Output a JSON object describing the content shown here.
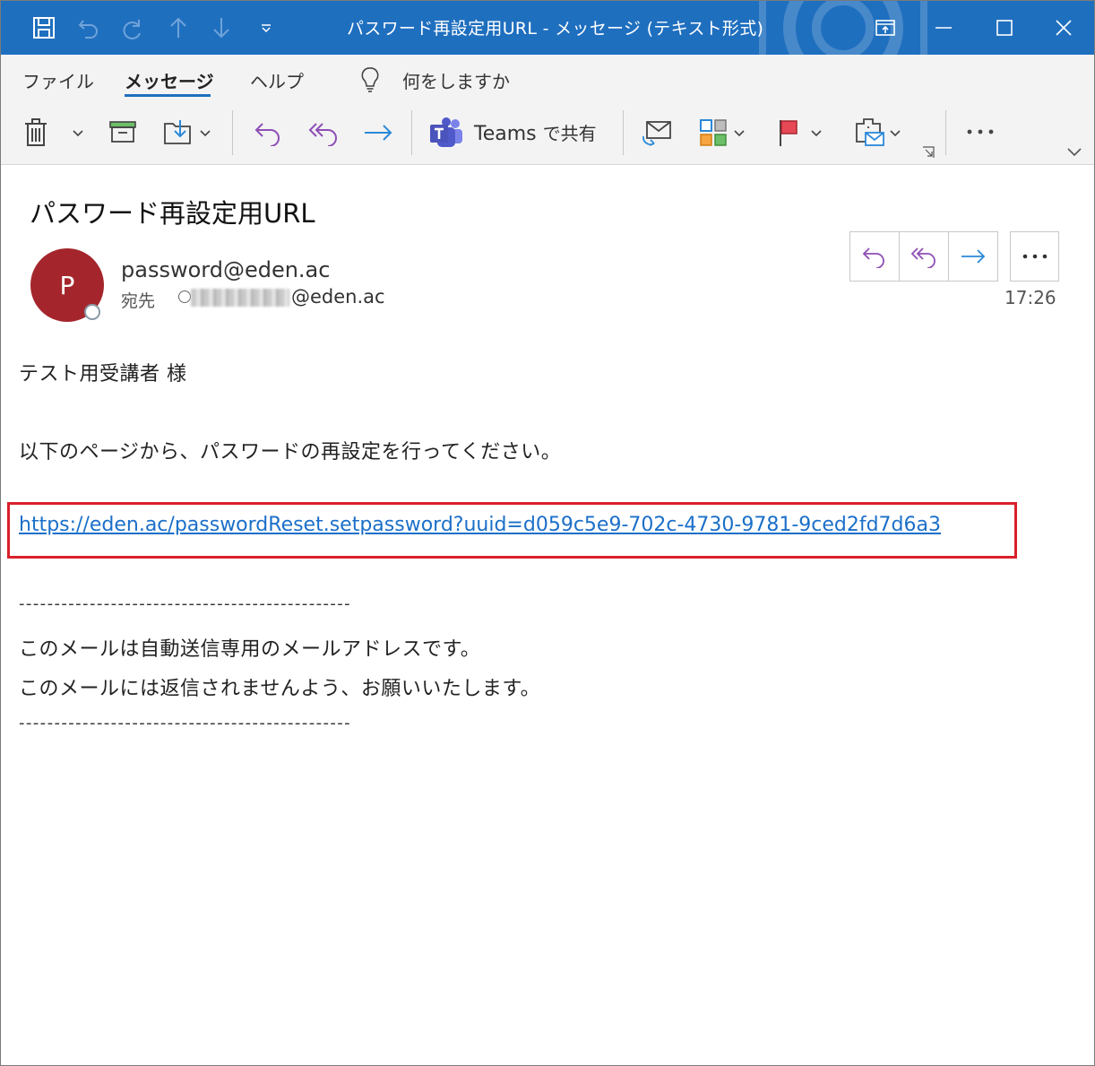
{
  "window": {
    "title": "パスワード再設定用URL  -  メッセージ (テキスト形式)"
  },
  "quick_access": [
    "save-icon",
    "undo-icon",
    "redo-icon",
    "up-arrow-icon",
    "down-arrow-icon",
    "customize-dropdown-icon"
  ],
  "ribbon": {
    "tabs": [
      "ファイル",
      "メッセージ",
      "ヘルプ"
    ],
    "active_tab": "メッセージ",
    "tell_me": "何をしますか",
    "teams_share": {
      "brand": "Teams",
      "suffix": "で共有"
    }
  },
  "message": {
    "subject": "パスワード再設定用URL",
    "avatar_initial": "P",
    "sender": "password@eden.ac",
    "to_label": "宛先",
    "to_domain": "@eden.ac",
    "time": "17:26",
    "body": {
      "greeting": "テスト用受講者 様",
      "instruction": "以下のページから、パスワードの再設定を行ってください。",
      "link": "https://eden.ac/passwordReset.setpassword?uuid=d059c5e9-702c-4730-9781-9ced2fd7d6a3",
      "separator": "-----------------------------------------------",
      "note1": "このメールは自動送信専用のメールアドレスです。",
      "note2": "このメールには返信されませんよう、お願いいたします。"
    }
  },
  "colors": {
    "titlebar": "#1f6fbf",
    "link": "#1b6fc9",
    "highlight": "#d9202b",
    "avatar": "#a4262c",
    "reply_purple": "#8e4fb5",
    "forward_blue": "#2b88d8"
  }
}
